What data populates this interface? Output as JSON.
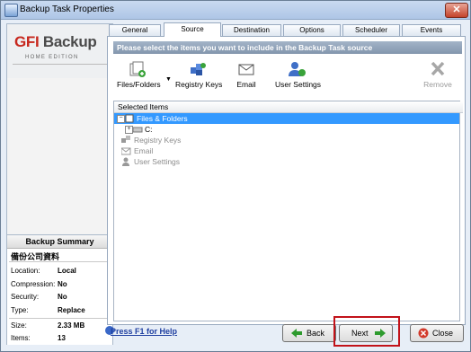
{
  "window": {
    "title": "Backup Task Properties",
    "close_icon": "close-icon"
  },
  "logo": {
    "brand_left": "GFI",
    "brand_right": "Backup",
    "edition": "HOME EDITION"
  },
  "tabs": [
    {
      "label": "General"
    },
    {
      "label": "Source"
    },
    {
      "label": "Destination"
    },
    {
      "label": "Options"
    },
    {
      "label": "Scheduler"
    },
    {
      "label": "Events"
    }
  ],
  "active_tab": "Source",
  "banner": "Please select the items you want to include in the Backup Task source",
  "toolbar": {
    "files_folders": "Files/Folders",
    "registry_keys": "Registry Keys",
    "email": "Email",
    "user_settings": "User Settings",
    "remove": "Remove"
  },
  "selected_items": {
    "header": "Selected Items",
    "rows": [
      {
        "label": "Files & Folders"
      },
      {
        "label": "C:"
      },
      {
        "label": "Registry Keys"
      },
      {
        "label": "Email"
      },
      {
        "label": "User Settings"
      }
    ]
  },
  "summary": {
    "title": "Backup Summary",
    "task_name": "備份公司資料",
    "location_label": "Location:",
    "location_value": "Local",
    "compression_label": "Compression:",
    "compression_value": "No",
    "security_label": "Security:",
    "security_value": "No",
    "type_label": "Type:",
    "type_value": "Replace",
    "size_label": "Size:",
    "size_value": "2.33 MB",
    "items_label": "Items:",
    "items_value": "13"
  },
  "footer": {
    "help": "Press F1 for Help",
    "back": "Back",
    "next": "Next",
    "close": "Close"
  },
  "colors": {
    "accent": "#3399ff",
    "highlight": "#c2121a",
    "banner": "#8396ad"
  }
}
